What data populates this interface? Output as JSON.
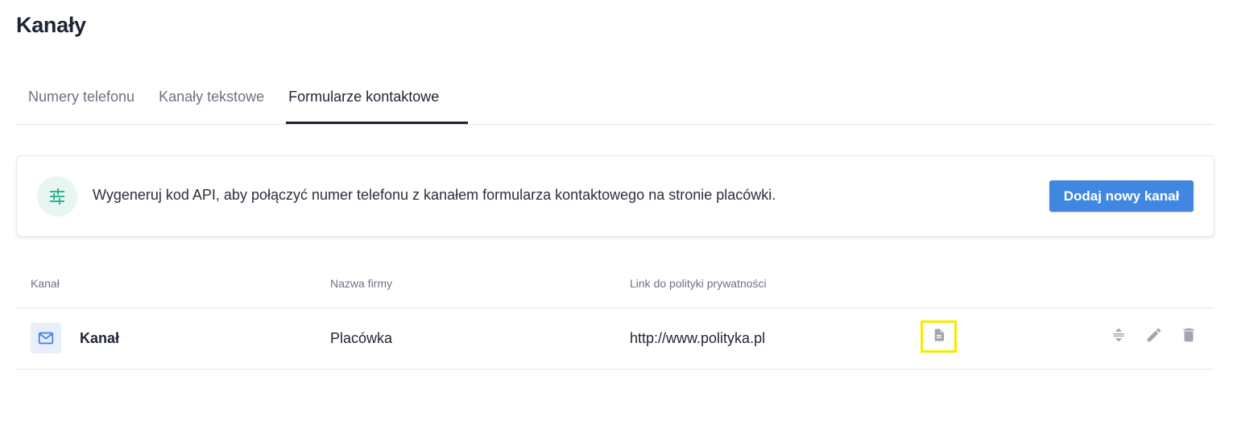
{
  "page": {
    "title": "Kanały"
  },
  "tabs": [
    {
      "label": "Numery telefonu",
      "active": false
    },
    {
      "label": "Kanały tekstowe",
      "active": false
    },
    {
      "label": "Formularze kontaktowe",
      "active": true
    }
  ],
  "info_card": {
    "icon": "sliders-icon",
    "text": "Wygeneruj kod API, aby połączyć numer telefonu z kanałem formularza kontaktowego na stronie placówki.",
    "button_label": "Dodaj nowy kanał",
    "accent_color": "#3f87e0"
  },
  "table": {
    "columns": [
      "Kanał",
      "Nazwa firmy",
      "Link do polityki prywatności"
    ],
    "rows": [
      {
        "icon": "envelope-icon",
        "channel": "Kanał",
        "company": "Placówka",
        "privacy_link": "http://www.polityka.pl",
        "actions": [
          "document-icon",
          "reorder-icon",
          "edit-icon",
          "delete-icon"
        ]
      }
    ]
  }
}
